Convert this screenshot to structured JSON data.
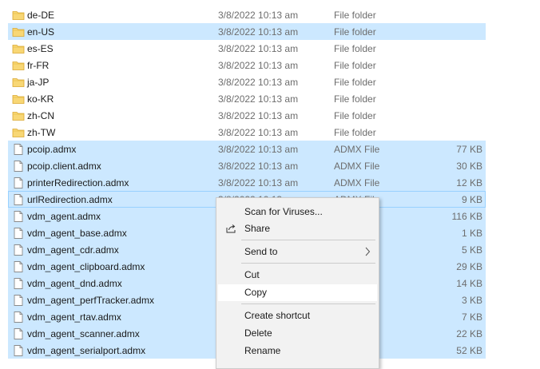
{
  "files": [
    {
      "name": "de-DE",
      "date": "3/8/2022 10:13 am",
      "type": "File folder",
      "size": "",
      "kind": "folder-icon",
      "selected": false,
      "focused": false
    },
    {
      "name": "en-US",
      "date": "3/8/2022 10:13 am",
      "type": "File folder",
      "size": "",
      "kind": "folder-icon",
      "selected": true,
      "focused": false
    },
    {
      "name": "es-ES",
      "date": "3/8/2022 10:13 am",
      "type": "File folder",
      "size": "",
      "kind": "folder-icon",
      "selected": false,
      "focused": false
    },
    {
      "name": "fr-FR",
      "date": "3/8/2022 10:13 am",
      "type": "File folder",
      "size": "",
      "kind": "folder-icon",
      "selected": false,
      "focused": false
    },
    {
      "name": "ja-JP",
      "date": "3/8/2022 10:13 am",
      "type": "File folder",
      "size": "",
      "kind": "folder-icon",
      "selected": false,
      "focused": false
    },
    {
      "name": "ko-KR",
      "date": "3/8/2022 10:13 am",
      "type": "File folder",
      "size": "",
      "kind": "folder-icon",
      "selected": false,
      "focused": false
    },
    {
      "name": "zh-CN",
      "date": "3/8/2022 10:13 am",
      "type": "File folder",
      "size": "",
      "kind": "folder-icon",
      "selected": false,
      "focused": false
    },
    {
      "name": "zh-TW",
      "date": "3/8/2022 10:13 am",
      "type": "File folder",
      "size": "",
      "kind": "folder-icon",
      "selected": false,
      "focused": false
    },
    {
      "name": "pcoip.admx",
      "date": "3/8/2022 10:13 am",
      "type": "ADMX File",
      "size": "77 KB",
      "kind": "file-icon",
      "selected": true,
      "focused": false
    },
    {
      "name": "pcoip.client.admx",
      "date": "3/8/2022 10:13 am",
      "type": "ADMX File",
      "size": "30 KB",
      "kind": "file-icon",
      "selected": true,
      "focused": false
    },
    {
      "name": "printerRedirection.admx",
      "date": "3/8/2022 10:13 am",
      "type": "ADMX File",
      "size": "12 KB",
      "kind": "file-icon",
      "selected": true,
      "focused": false
    },
    {
      "name": "urlRedirection.admx",
      "date": "3/8/2022 10:13",
      "type": "ADMX File",
      "size": "9 KB",
      "kind": "file-icon",
      "selected": true,
      "focused": true
    },
    {
      "name": "vdm_agent.admx",
      "date": "",
      "type": "",
      "size": "116 KB",
      "kind": "file-icon",
      "selected": true,
      "focused": false
    },
    {
      "name": "vdm_agent_base.admx",
      "date": "",
      "type": "",
      "size": "1 KB",
      "kind": "file-icon",
      "selected": true,
      "focused": false
    },
    {
      "name": "vdm_agent_cdr.admx",
      "date": "",
      "type": "",
      "size": "5 KB",
      "kind": "file-icon",
      "selected": true,
      "focused": false
    },
    {
      "name": "vdm_agent_clipboard.admx",
      "date": "",
      "type": "",
      "size": "29 KB",
      "kind": "file-icon",
      "selected": true,
      "focused": false
    },
    {
      "name": "vdm_agent_dnd.admx",
      "date": "",
      "type": "",
      "size": "14 KB",
      "kind": "file-icon",
      "selected": true,
      "focused": false
    },
    {
      "name": "vdm_agent_perfTracker.admx",
      "date": "",
      "type": "",
      "size": "3 KB",
      "kind": "file-icon",
      "selected": true,
      "focused": false
    },
    {
      "name": "vdm_agent_rtav.admx",
      "date": "",
      "type": "",
      "size": "7 KB",
      "kind": "file-icon",
      "selected": true,
      "focused": false
    },
    {
      "name": "vdm_agent_scanner.admx",
      "date": "",
      "type": "",
      "size": "22 KB",
      "kind": "file-icon",
      "selected": true,
      "focused": false
    },
    {
      "name": "vdm_agent_serialport.admx",
      "date": "",
      "type": "",
      "size": "52 KB",
      "kind": "file-icon",
      "selected": true,
      "focused": false
    }
  ],
  "context_menu": {
    "items": [
      {
        "label": "Scan for Viruses...",
        "name": "menu-item-scan-for-viruses",
        "icon": "",
        "submenu": false,
        "hover": false
      },
      {
        "label": "Share",
        "name": "menu-item-share",
        "icon": "share-icon",
        "submenu": false,
        "hover": false
      },
      {
        "label": "Send to",
        "name": "menu-item-send-to",
        "icon": "",
        "submenu": true,
        "hover": false
      },
      {
        "label": "Cut",
        "name": "menu-item-cut",
        "icon": "",
        "submenu": false,
        "hover": false
      },
      {
        "label": "Copy",
        "name": "menu-item-copy",
        "icon": "",
        "submenu": false,
        "hover": true
      },
      {
        "label": "Create shortcut",
        "name": "menu-item-create-shortcut",
        "icon": "",
        "submenu": false,
        "hover": false
      },
      {
        "label": "Delete",
        "name": "menu-item-delete",
        "icon": "",
        "submenu": false,
        "hover": false
      },
      {
        "label": "Rename",
        "name": "menu-item-rename",
        "icon": "",
        "submenu": false,
        "hover": false
      }
    ]
  },
  "colors": {
    "selection": "#cce8ff",
    "focus_border": "#99d1ff",
    "folder": "#f8d775",
    "menu_bg": "#f2f2f2",
    "secondary_text": "#6d6d6d"
  }
}
